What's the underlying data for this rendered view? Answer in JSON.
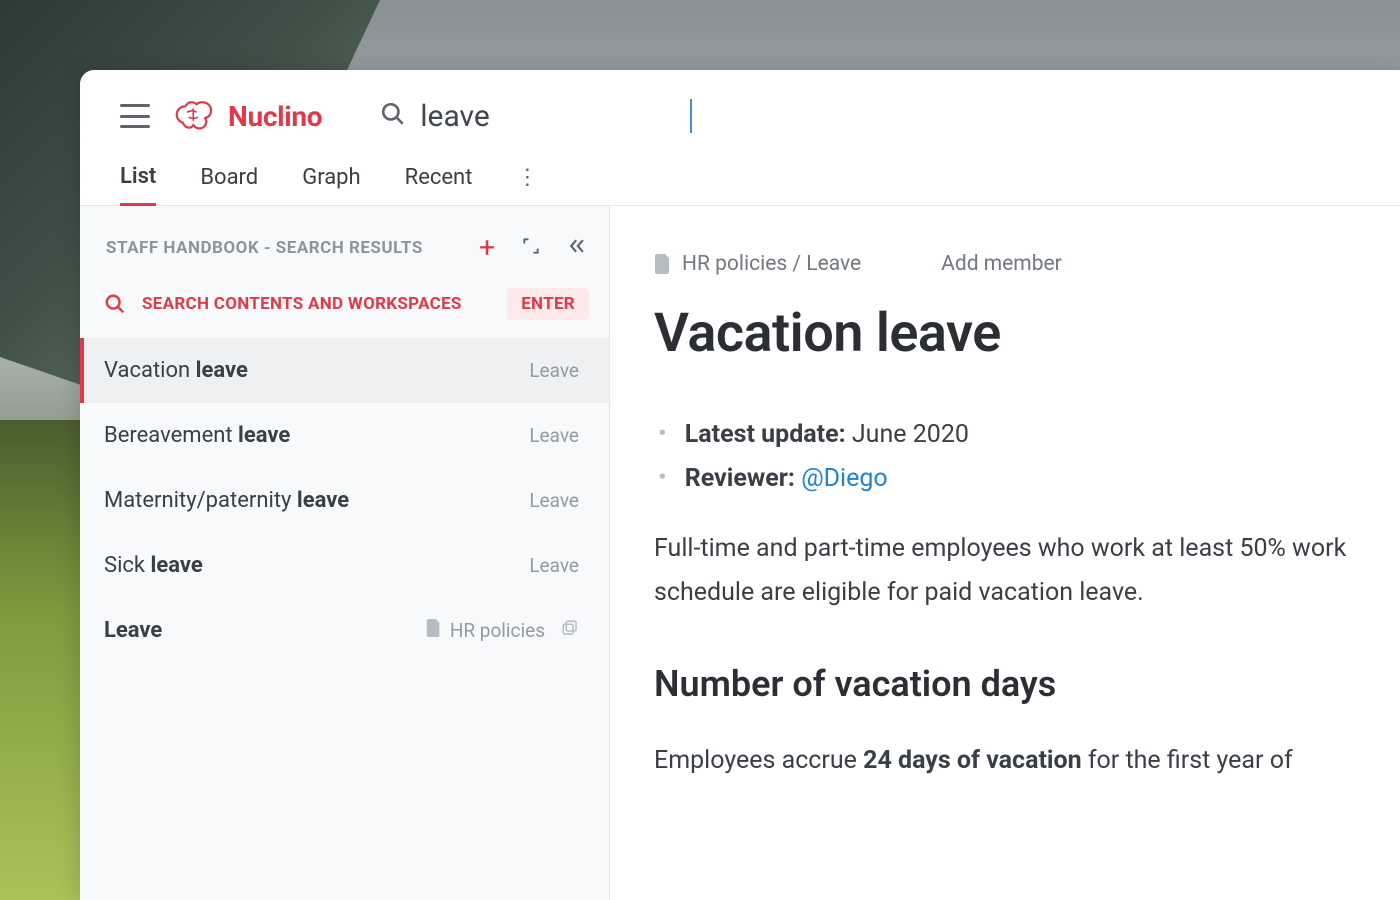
{
  "brand": {
    "name": "Nuclino"
  },
  "search": {
    "value": "leave"
  },
  "tabs": {
    "list": "List",
    "board": "Board",
    "graph": "Graph",
    "recent": "Recent"
  },
  "sidebar": {
    "heading": "STAFF HANDBOOK - SEARCH RESULTS",
    "search_all_label": "SEARCH CONTENTS AND WORKSPACES",
    "enter_badge": "ENTER",
    "results": [
      {
        "pre": "Vacation ",
        "bold": "leave",
        "cat": "Leave"
      },
      {
        "pre": "Bereavement ",
        "bold": "leave",
        "cat": "Leave"
      },
      {
        "pre": "Maternity/paternity ",
        "bold": "leave",
        "cat": "Leave"
      },
      {
        "pre": "Sick ",
        "bold": "leave",
        "cat": "Leave"
      }
    ],
    "last": {
      "title": "Leave",
      "cat": "HR policies"
    }
  },
  "doc": {
    "breadcrumb": "HR policies / Leave",
    "add_member": "Add member",
    "title": "Vacation leave",
    "latest_update_label": "Latest update:",
    "latest_update_value": " June 2020",
    "reviewer_label": "Reviewer:",
    "reviewer_mention": "@Diego",
    "body1": "Full-time and part-time employees who work at least 50% work schedule are eligible for paid vacation leave.",
    "h2": "Number of vacation days",
    "body2_pre": "Employees accrue ",
    "body2_bold": "24 days of vacation",
    "body2_post": " for the first year of"
  }
}
